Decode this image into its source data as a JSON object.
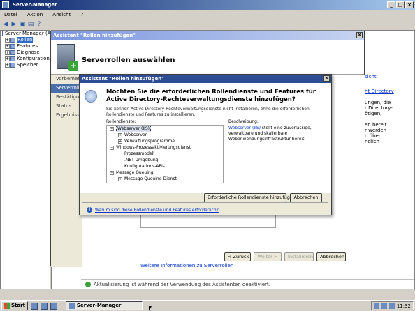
{
  "main_window": {
    "title": "Server-Manager",
    "menu": [
      "Datei",
      "Aktion",
      "Ansicht",
      "?"
    ]
  },
  "tree": {
    "items": [
      {
        "label": "Server-Manager (A",
        "level": 0,
        "expander": ""
      },
      {
        "label": "Rollen",
        "level": 1,
        "expander": "+",
        "selected": true
      },
      {
        "label": "Features",
        "level": 1,
        "expander": "+"
      },
      {
        "label": "Diagnose",
        "level": 1,
        "expander": "+"
      },
      {
        "label": "Konfiguration",
        "level": 1,
        "expander": "+"
      },
      {
        "label": "Speicher",
        "level": 1,
        "expander": "+"
      }
    ]
  },
  "right_pane": {
    "fragments": [
      "sicht",
      "ht Directory",
      "ungen, die",
      "r Directory-",
      "ötigen,",
      "en bereit.",
      "r werden",
      "n über",
      "ndlich"
    ]
  },
  "bg_wizard": {
    "title": "Assistent \"Rollen hinzufügen\"",
    "heading": "Serverrollen auswählen",
    "nav": [
      "Vorbemerku",
      "Serverroll",
      "Bestätigung",
      "Status",
      "Ergebnisse"
    ],
    "link": "Weitere Informationen zu Serverrollen",
    "buttons": {
      "back": "< Zurück",
      "next": "Weiter >",
      "install": "Installieren",
      "cancel": "Abbrechen"
    }
  },
  "status_strip": "Aktualisierung ist während der Verwendung des Assistenten deaktiviert.",
  "dialog": {
    "title": "Assistent \"Rollen hinzufügen\"",
    "question": "Möchten Sie die erforderlichen Rollendienste und Features für Active Directory-Rechteverwaltungsdienste hinzufügen?",
    "description": "Sie können Active Directory-Rechteverwaltungsdienste nicht installieren, ohne die erforderlichen Rollendienste und Features zu installieren.",
    "roles_label": "Rollendienste:",
    "desc_label": "Beschreibung:",
    "roles": [
      {
        "label": "Webserver (IIS)",
        "indent": "l0",
        "expander": "−",
        "highlight": true
      },
      {
        "label": "Webserver",
        "indent": "l1",
        "expander": "+"
      },
      {
        "label": "Verwaltungsprogramme",
        "indent": "l1",
        "expander": "+"
      },
      {
        "label": "Windows-Prozessaktivierungsdienst",
        "indent": "l0",
        "expander": "−"
      },
      {
        "label": "Prozessmodell",
        "indent": "l1n",
        "expander": ""
      },
      {
        "label": ".NET-Umgebung",
        "indent": "l1n",
        "expander": ""
      },
      {
        "label": "Konfigurations-APIs",
        "indent": "l1n",
        "expander": ""
      },
      {
        "label": "Message Queuing",
        "indent": "l0",
        "expander": "−"
      },
      {
        "label": "Message Queuing-Dienst",
        "indent": "l1",
        "expander": "+"
      }
    ],
    "desc_link": "Webserver (IIS)",
    "desc_rest": " stellt eine zuverlässige, verwaltbare und skalierbare Webanwendungsinfrastruktur bereit.",
    "buttons": {
      "add": "Erforderliche Rollendienste hinzufügen",
      "cancel": "Abbrechen"
    },
    "help_link": "Warum sind diese Rollendienste und Features erforderlich?"
  },
  "taskbar": {
    "start": "Start",
    "task": "Server-Manager",
    "clock": "11:32"
  }
}
